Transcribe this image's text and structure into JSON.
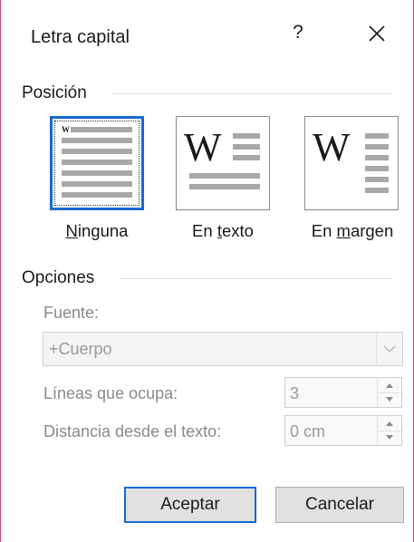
{
  "dialog": {
    "title": "Letra capital",
    "help_label": "?",
    "close_icon": "close-icon"
  },
  "position_section": {
    "heading": "Posición",
    "options": [
      {
        "label_pre": "",
        "label_acc": "N",
        "label_post": "inguna",
        "selected": true
      },
      {
        "label_pre": "En ",
        "label_acc": "t",
        "label_post": "exto",
        "selected": false
      },
      {
        "label_pre": "En ",
        "label_acc": "m",
        "label_post": "argen",
        "selected": false
      }
    ],
    "preview_letter": "W"
  },
  "options_section": {
    "heading": "Opciones",
    "font_label": "Fuente:",
    "font_value": "+Cuerpo",
    "lines_label": "Líneas que ocupa:",
    "lines_value": "3",
    "distance_label": "Distancia desde el texto:",
    "distance_value": "0 cm"
  },
  "buttons": {
    "ok": "Aceptar",
    "cancel": "Cancelar"
  },
  "colors": {
    "accent": "#1769d1",
    "window_border": "#c9497a",
    "disabled_text": "#8a8a8a"
  }
}
